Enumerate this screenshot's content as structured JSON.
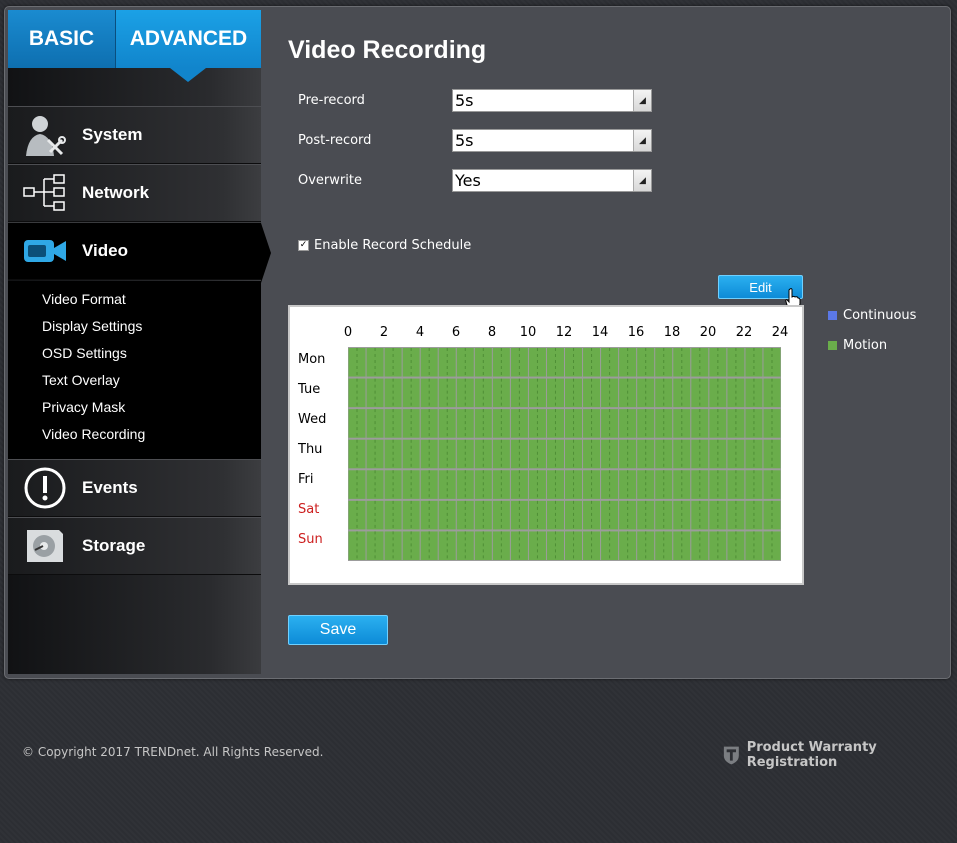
{
  "mode_tabs": {
    "basic": "BASIC",
    "advanced": "ADVANCED"
  },
  "nav": [
    {
      "label": "System",
      "icon": "system-tools-icon"
    },
    {
      "label": "Network",
      "icon": "network-tree-icon"
    },
    {
      "label": "Video",
      "icon": "video-camera-icon"
    },
    {
      "label": "Events",
      "icon": "alert-icon"
    },
    {
      "label": "Storage",
      "icon": "storage-disk-icon"
    }
  ],
  "video_submenu": [
    "Video Format",
    "Display Settings",
    "OSD Settings",
    "Text Overlay",
    "Privacy Mask",
    "Video Recording"
  ],
  "page_title": "Video Recording",
  "fields": {
    "pre_record": {
      "label": "Pre-record",
      "value": "5s"
    },
    "post_record": {
      "label": "Post-record",
      "value": "5s"
    },
    "overwrite": {
      "label": "Overwrite",
      "value": "Yes"
    }
  },
  "enable_schedule": {
    "label": "Enable Record Schedule",
    "checked": true
  },
  "edit_label": "Edit",
  "schedule": {
    "hours": [
      "0",
      "2",
      "4",
      "6",
      "8",
      "10",
      "12",
      "14",
      "16",
      "18",
      "20",
      "22",
      "24"
    ],
    "days": [
      "Mon",
      "Tue",
      "Wed",
      "Thu",
      "Fri",
      "Sat",
      "Sun"
    ],
    "weekend_color": "#cc1f1f",
    "mode_all_slots": "Motion"
  },
  "legend": [
    {
      "label": "Continuous",
      "color": "#5b78e6"
    },
    {
      "label": "Motion",
      "color": "#6aad4b"
    }
  ],
  "save_label": "Save",
  "footer": {
    "copyright": "© Copyright 2017 TRENDnet. All Rights Reserved.",
    "warranty": "Product Warranty Registration"
  },
  "colors": {
    "accent": "#1ba1e6",
    "motion": "#6aad4b",
    "continuous": "#5b78e6"
  }
}
